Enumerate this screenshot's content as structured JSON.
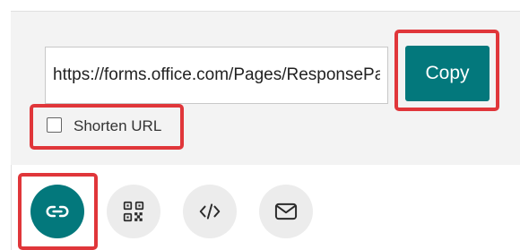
{
  "share": {
    "url_value": "https://forms.office.com/Pages/ResponsePage.aspx",
    "copy_label": "Copy",
    "shorten_label": "Shorten URL",
    "shorten_checked": false,
    "options": [
      {
        "name": "link",
        "icon": "link-icon",
        "selected": true
      },
      {
        "name": "qr-code",
        "icon": "qr-code-icon",
        "selected": false
      },
      {
        "name": "embed",
        "icon": "embed-code-icon",
        "selected": false
      },
      {
        "name": "email",
        "icon": "mail-icon",
        "selected": false
      }
    ]
  },
  "colors": {
    "accent": "#03787c",
    "highlight": "#e0363a",
    "icon_inactive": "#2b2b2b"
  }
}
